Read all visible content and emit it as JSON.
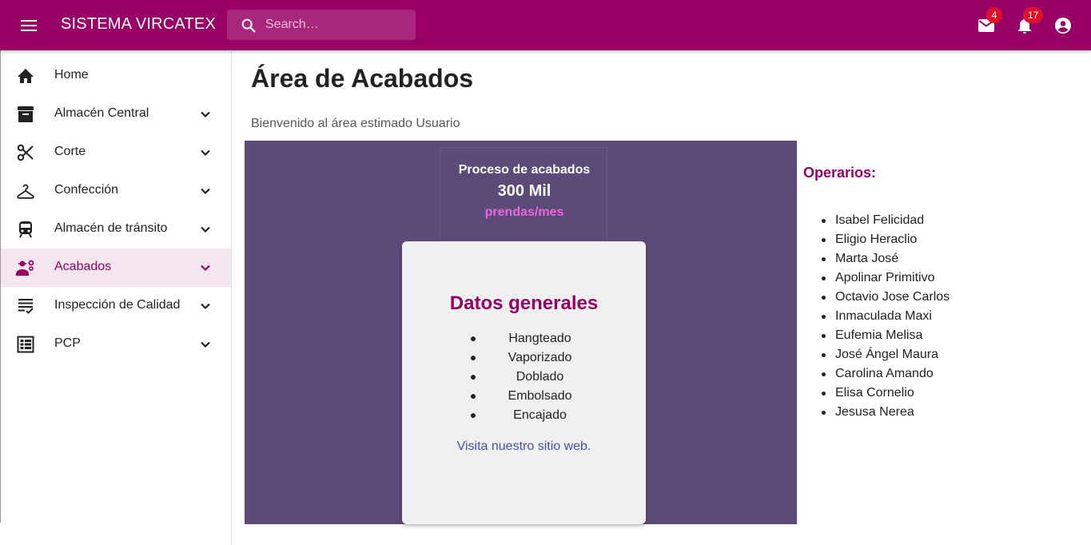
{
  "colors": {
    "brand": "#990066",
    "panel_bg": "#5c4b78",
    "active_item_bg": "#f5e5ef",
    "badge": "#e0102a",
    "link": "#3f51b5",
    "stat_unit": "#e86ad8"
  },
  "header": {
    "title": "SISTEMA VIRCATEX",
    "search_placeholder": "Search…",
    "mail_badge": "4",
    "notifications_badge": "17",
    "icons": [
      "menu-icon",
      "search-icon",
      "mail-icon",
      "bell-icon",
      "account-circle-icon"
    ]
  },
  "sidebar": {
    "items": [
      {
        "label": "Home",
        "icon": "home-icon",
        "expandable": false,
        "active": false
      },
      {
        "label": "Almacén Central",
        "icon": "archive-icon",
        "expandable": true,
        "active": false
      },
      {
        "label": "Corte",
        "icon": "scissors-icon",
        "expandable": true,
        "active": false
      },
      {
        "label": "Confección",
        "icon": "hanger-icon",
        "expandable": true,
        "active": false
      },
      {
        "label": "Almacén de tránsito",
        "icon": "train-icon",
        "expandable": true,
        "active": false
      },
      {
        "label": "Acabados",
        "icon": "engineering-icon",
        "expandable": true,
        "active": true
      },
      {
        "label": "Inspección de Calidad",
        "icon": "checklist-icon",
        "expandable": true,
        "active": false
      },
      {
        "label": "PCP",
        "icon": "calendar-grid-icon",
        "expandable": true,
        "active": false
      }
    ]
  },
  "main": {
    "title": "Área de Acabados",
    "welcome": "Bienvenido al área estimado Usuario",
    "stat": {
      "label": "Proceso de acabados",
      "value": "300 Mil",
      "unit": "prendas/mes"
    },
    "card": {
      "title": "Datos generales",
      "items": [
        "Hangteado",
        "Vaporizado",
        "Doblado",
        "Embolsado",
        "Encajado"
      ],
      "link": "Visita nuestro sitio web."
    },
    "operarios": {
      "title": "Operarios:",
      "names": [
        "Isabel Felicidad",
        "Eligio Heraclio",
        "Marta José",
        "Apolinar Primitivo",
        "Octavio Jose Carlos",
        "Inmaculada Maxi",
        "Eufemia Melisa",
        "José Ángel Maura",
        "Carolina Amando",
        "Elisa Cornelio",
        "Jesusa Nerea"
      ]
    }
  }
}
